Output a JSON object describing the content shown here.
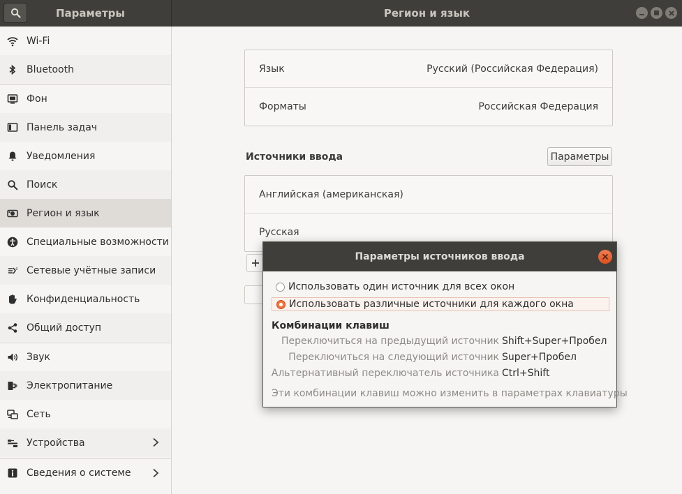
{
  "window": {
    "app_title": "Параметры",
    "page_title": "Регион и язык"
  },
  "sidebar": {
    "items": [
      {
        "label": "Wi-Fi",
        "icon": "wifi-icon"
      },
      {
        "label": "Bluetooth",
        "icon": "bluetooth-icon"
      },
      {
        "label": "Фон",
        "icon": "background-icon"
      },
      {
        "label": "Панель задач",
        "icon": "dock-icon"
      },
      {
        "label": "Уведомления",
        "icon": "bell-icon"
      },
      {
        "label": "Поиск",
        "icon": "search-icon"
      },
      {
        "label": "Регион и язык",
        "icon": "region-icon",
        "selected": true
      },
      {
        "label": "Специальные возможности",
        "icon": "accessibility-icon"
      },
      {
        "label": "Сетевые учётные записи",
        "icon": "online-accounts-icon"
      },
      {
        "label": "Конфиденциальность",
        "icon": "privacy-hand-icon"
      },
      {
        "label": "Общий доступ",
        "icon": "share-icon"
      },
      {
        "label": "Звук",
        "icon": "speaker-icon"
      },
      {
        "label": "Электропитание",
        "icon": "power-plug-icon"
      },
      {
        "label": "Сеть",
        "icon": "network-icon"
      },
      {
        "label": "Устройства",
        "icon": "devices-icon",
        "chevron": true
      },
      {
        "label": "Сведения о системе",
        "icon": "info-icon",
        "chevron": true
      }
    ]
  },
  "region": {
    "language_label": "Язык",
    "language_value": "Русский (Российская Федерация)",
    "formats_label": "Форматы",
    "formats_value": "Российская Федерация",
    "input_sources_heading": "Источники ввода",
    "params_button": "Параметры",
    "sources": [
      "Английская (американская)",
      "Русская"
    ]
  },
  "dialog": {
    "title": "Параметры источников ввода",
    "option_same": "Использовать один источник для всех окон",
    "option_per_window": "Использовать различные источники для каждого окна",
    "selected_option": "per_window",
    "shortcuts_heading": "Комбинации клавиш",
    "shortcuts": [
      {
        "label": "Переключиться на предыдущий источник",
        "keys": "Shift+Super+Пробел"
      },
      {
        "label": "Переключиться на следующий источник",
        "keys": "Super+Пробел"
      },
      {
        "label": "Альтернативный переключатель источника",
        "keys": "Ctrl+Shift"
      }
    ],
    "note": "Эти комбинации клавиш можно изменить в параметрах клавиатуры"
  },
  "colors": {
    "header_bg": "#3f3e3a",
    "accent": "#e95420",
    "selected_bg": "#dfdcd8"
  }
}
